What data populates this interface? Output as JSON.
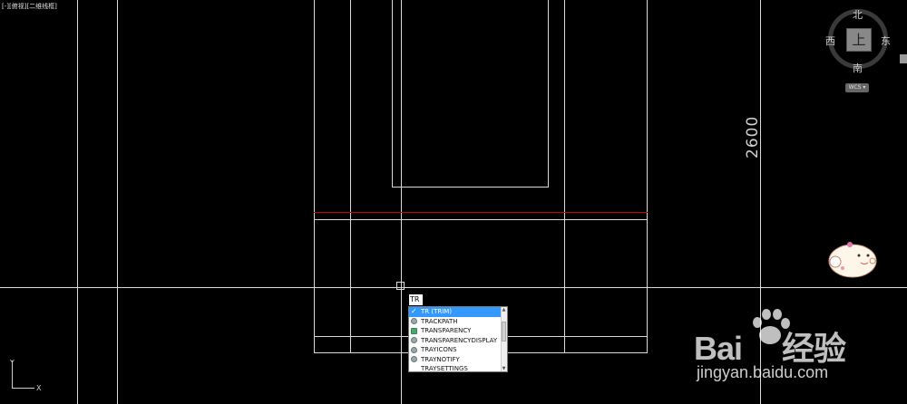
{
  "viewport": {
    "label": "[-][俯视][二维线框]"
  },
  "navigation": {
    "compass_north": "北",
    "compass_south": "南",
    "compass_east": "东",
    "compass_west": "西",
    "cube_face": "上",
    "wcs_label": "WCS ▾"
  },
  "drawing": {
    "dimension_text": "2600",
    "line_color": "#d9d9d9",
    "accent_line_color": "#cc0000"
  },
  "command": {
    "input_value": "TR",
    "autocomplete": [
      {
        "label": "TR (TRIM)",
        "icon": "check-icon",
        "selected": true
      },
      {
        "label": "TRACKPATH",
        "icon": "gear-icon",
        "selected": false
      },
      {
        "label": "TRANSPARENCY",
        "icon": "window-icon",
        "selected": false
      },
      {
        "label": "TRANSPARENCYDISPLAY",
        "icon": "gear-icon",
        "selected": false
      },
      {
        "label": "TRAYICONS",
        "icon": "gear-icon",
        "selected": false
      },
      {
        "label": "TRAYNOTIFY",
        "icon": "gear-icon",
        "selected": false
      },
      {
        "label": "TRAYSETTINGS",
        "icon": "none",
        "selected": false
      }
    ]
  },
  "ucs": {
    "x_label": "X",
    "y_label": "Y"
  },
  "watermark": {
    "logo_left": "Bai",
    "logo_right": "经验",
    "url": "jingyan.baidu.com"
  }
}
